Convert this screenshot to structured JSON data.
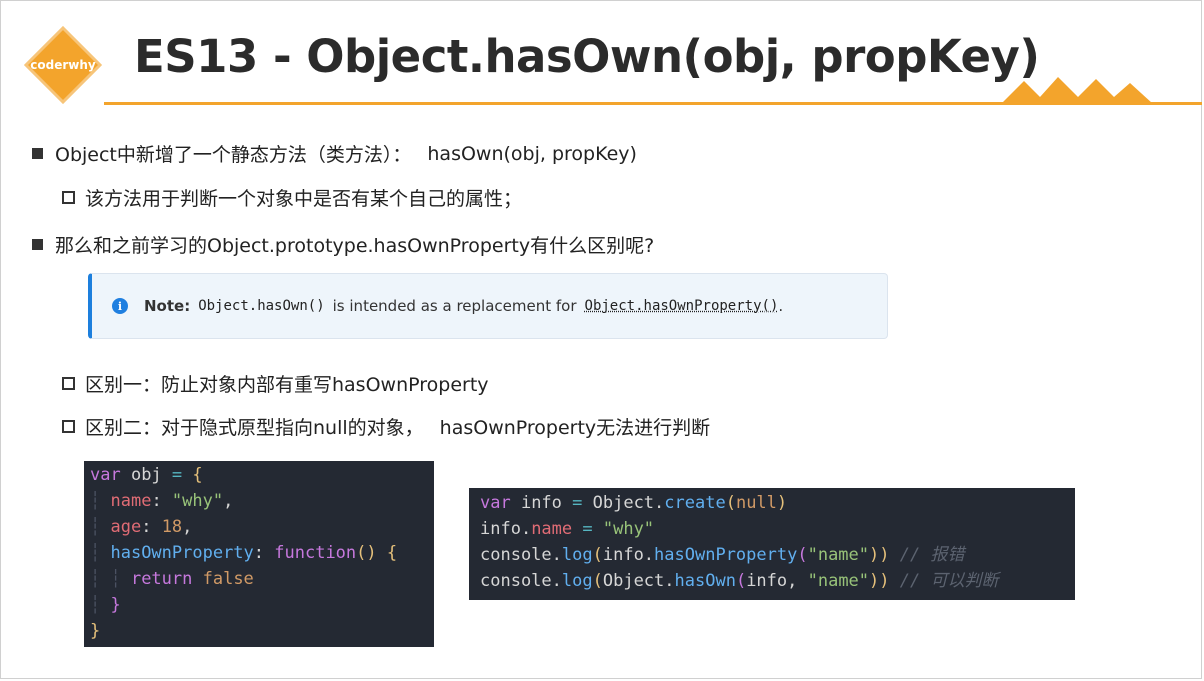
{
  "header": {
    "logo_text": "coderwhy",
    "title": "ES13 - Object.hasOwn(obj, propKey)"
  },
  "bullets": {
    "b1": {
      "text": "Object中新增了一个静态方法（类方法）：",
      "code": "hasOwn(obj, propKey)"
    },
    "b1_sub": "该方法用于判断一个对象中是否有某个自己的属性；",
    "b2": "那么和之前学习的Object.prototype.hasOwnProperty有什么区别呢?",
    "diff1": "区别一：防止对象内部有重写hasOwnProperty",
    "diff2": {
      "text": "区别二：对于隐式原型指向null的对象，",
      "code": "hasOwnProperty无法进行判断"
    }
  },
  "note": {
    "label": "Note:",
    "code1": "Object.hasOwn()",
    "text": "is intended as a replacement for",
    "link": "Object.hasOwnProperty()",
    "end": "."
  },
  "code_left": {
    "l1": {
      "kw": "var",
      "name": " obj ",
      "op": "=",
      "brace": " {"
    },
    "l2": {
      "prop": "name",
      "colon": ": ",
      "str": "\"why\"",
      "comma": ","
    },
    "l3": {
      "prop": "age",
      "colon": ": ",
      "num": "18",
      "comma": ","
    },
    "l4": {
      "prop": "hasOwnProperty",
      "colon": ": ",
      "kw": "function",
      "paren": "()",
      "brace": " {"
    },
    "l5": {
      "kw": "return",
      "val": " false"
    },
    "l6": {
      "brace": "}"
    },
    "l7": {
      "brace": "}"
    }
  },
  "code_right": {
    "l1": {
      "kw": "var",
      "name": " info ",
      "op": "=",
      "obj": " Object.",
      "fn": "create",
      "p1": "(",
      "null": "null",
      "p2": ")"
    },
    "l2": {
      "obj": "info.",
      "prop": "name",
      "op": " = ",
      "str": "\"why\""
    },
    "l3": {
      "obj": "console.",
      "fn": "log",
      "p1": "(",
      "obj2": "info.",
      "fn2": "hasOwnProperty",
      "p2": "(",
      "str": "\"name\"",
      "p3": "))",
      "cm": " // 报错"
    },
    "l4": {
      "obj": "console.",
      "fn": "log",
      "p1": "(",
      "obj2": "Object.",
      "fn2": "hasOwn",
      "p2": "(",
      "arg": "info, ",
      "str": "\"name\"",
      "p3": "))",
      "cm": " // 可以判断"
    }
  },
  "colors": {
    "accent": "#f3a42c",
    "note_border": "#1d7fdd",
    "code_bg": "#242933"
  }
}
